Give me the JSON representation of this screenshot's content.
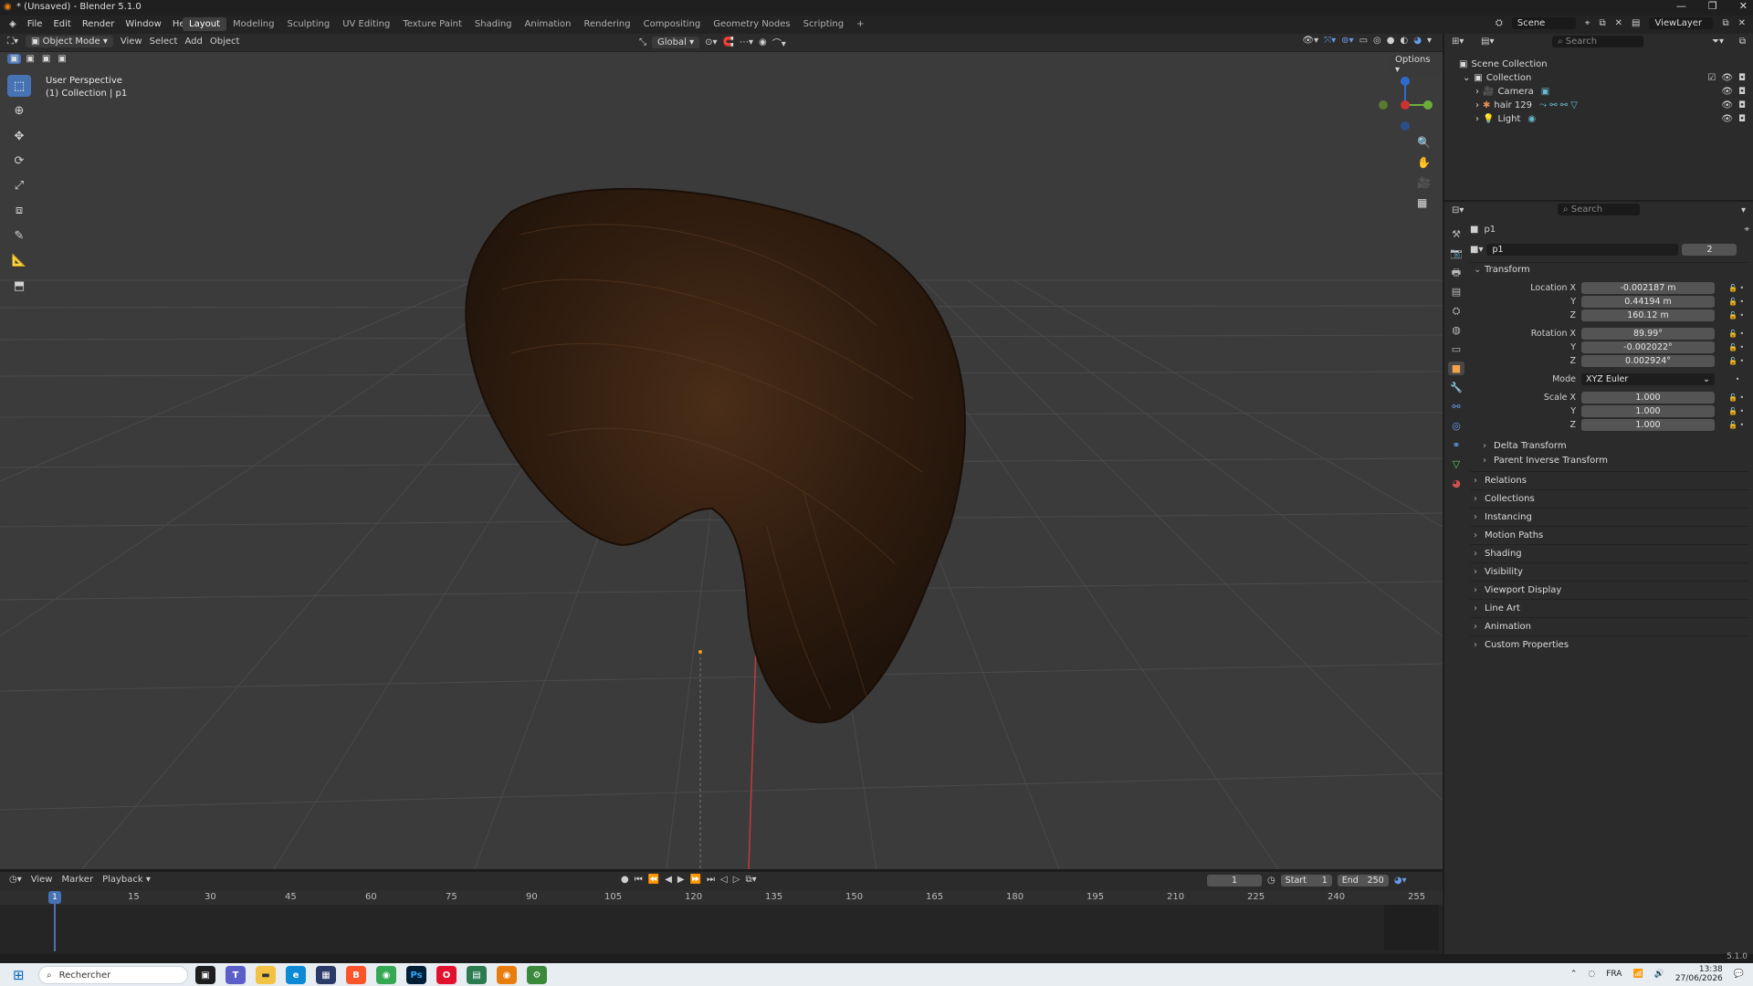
{
  "window": {
    "title": "* (Unsaved) - Blender 5.1.0"
  },
  "menu": [
    "File",
    "Edit",
    "Render",
    "Window",
    "Help"
  ],
  "workspaces": [
    "Layout",
    "Modeling",
    "Sculpting",
    "UV Editing",
    "Texture Paint",
    "Shading",
    "Animation",
    "Rendering",
    "Compositing",
    "Geometry Nodes",
    "Scripting"
  ],
  "active_workspace": "Layout",
  "topright": {
    "scene": "Scene",
    "view_layer": "ViewLayer"
  },
  "viewport_header": {
    "mode": "Object Mode",
    "menus": [
      "View",
      "Select",
      "Add",
      "Object"
    ],
    "orientation": "Global",
    "options": "Options"
  },
  "viewport": {
    "perspective": "User Perspective",
    "context": "(1) Collection | p1"
  },
  "timeline": {
    "menus": [
      "View",
      "Marker",
      "Playback"
    ],
    "current_frame": "1",
    "start_label": "Start",
    "start": "1",
    "end_label": "End",
    "end": "250",
    "ticks": [
      "1",
      "15",
      "30",
      "45",
      "60",
      "75",
      "90",
      "105",
      "120",
      "135",
      "150",
      "165",
      "180",
      "195",
      "210",
      "225",
      "240",
      "255"
    ]
  },
  "outliner": {
    "search_placeholder": "Search",
    "root": "Scene Collection",
    "collection": "Collection",
    "items": [
      "Camera",
      "hair 129",
      "Light"
    ]
  },
  "properties": {
    "search_placeholder": "Search",
    "object_name": "p1",
    "data_name": "p1",
    "users": "2",
    "transform_title": "Transform",
    "location": {
      "label": "Location X",
      "x": "-0.002187 m",
      "y": "0.44194 m",
      "z": "160.12 m"
    },
    "rotation": {
      "label": "Rotation X",
      "x": "89.99°",
      "y": "-0.002022°",
      "z": "0.002924°"
    },
    "mode_label": "Mode",
    "mode": "XYZ Euler",
    "scale": {
      "label": "Scale X",
      "x": "1.000",
      "y": "1.000",
      "z": "1.000"
    },
    "axis_y": "Y",
    "axis_z": "Z",
    "subpanels": [
      "Delta Transform",
      "Parent Inverse Transform"
    ],
    "panels": [
      "Relations",
      "Collections",
      "Instancing",
      "Motion Paths",
      "Shading",
      "Visibility",
      "Viewport Display",
      "Line Art",
      "Animation",
      "Custom Properties"
    ]
  },
  "status": {
    "version": "5.1.0"
  },
  "taskbar": {
    "search": "Rechercher",
    "lang": "FRA",
    "time": "13:38",
    "date": "27/06/2026"
  }
}
